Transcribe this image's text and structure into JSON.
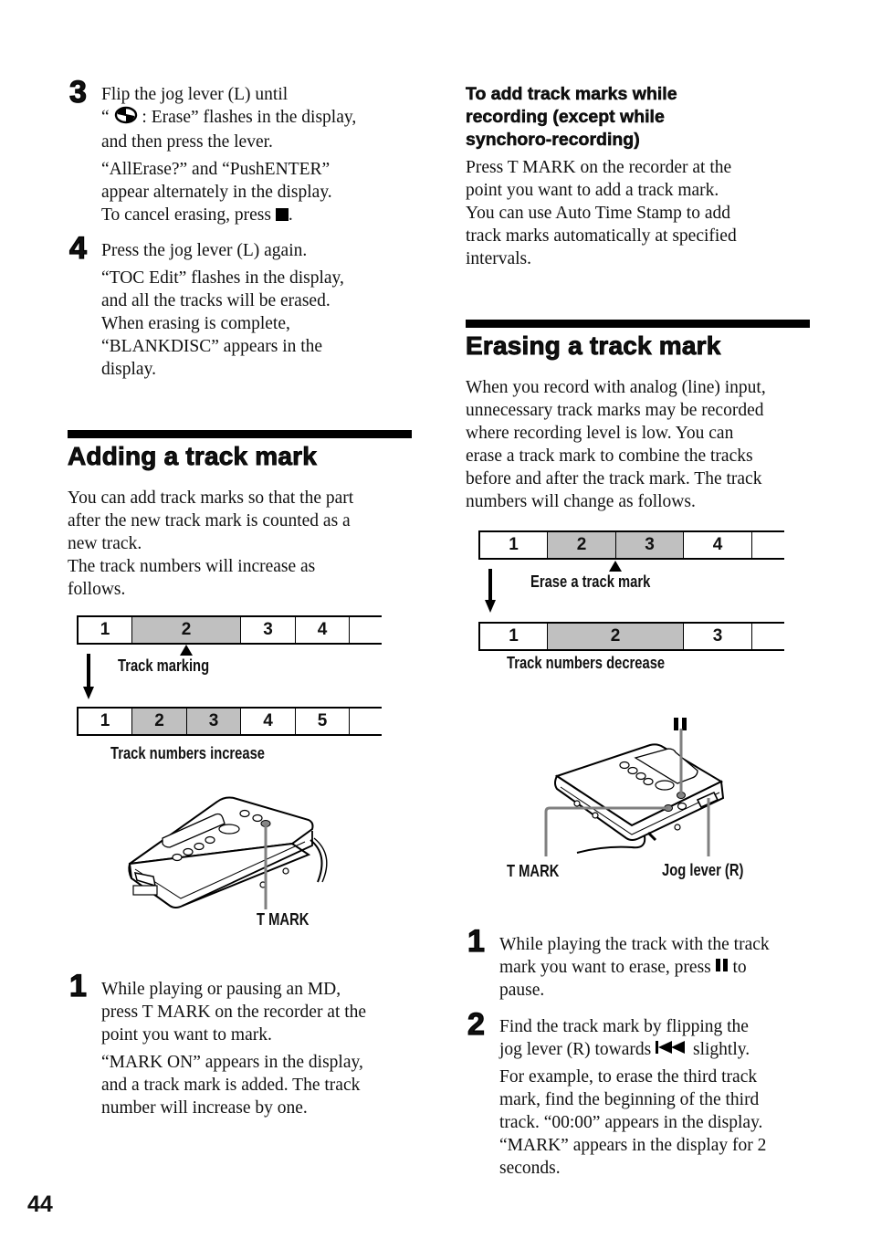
{
  "page_number": "44",
  "left_column": {
    "steps_top": [
      {
        "number": "3",
        "paragraphs": [
          [
            "Flip the jog lever (L) until",
            "“",
            "erase-disc-icon",
            ": Erase” flashes in the display,",
            "and then press the lever."
          ],
          [
            "“AllErase?” and “PushENTER”",
            "appear alternately in the display.",
            "To cancel erasing, press",
            "stop-icon",
            "."
          ]
        ],
        "line1": "Flip the jog lever (L) until",
        "line2_pre": "“",
        "line2_post": " : Erase” flashes in the display,",
        "line3": "and then press the lever.",
        "note1": "“AllErase?” and “PushENTER”",
        "note2": "appear alternately in the display.",
        "note3_pre": "To cancel erasing, press ",
        "note3_post": "."
      },
      {
        "number": "4",
        "line1": "Press the jog lever (L) again.",
        "note1": "“TOC Edit” flashes in the display,",
        "note2": "and all the tracks will be erased.",
        "note3": "When erasing is complete,",
        "note4": "“BLANKDISC” appears in the",
        "note5": "display."
      }
    ],
    "section": {
      "title": "Adding a track mark",
      "intro": [
        "You can add track marks so that the part",
        "after the new track mark is counted as a",
        "new track.",
        "The track numbers will increase as",
        "follows."
      ],
      "diagram": {
        "before_tracks": [
          {
            "label": "1",
            "shaded": false
          },
          {
            "label": "2",
            "shaded": true
          },
          {
            "label": "3",
            "shaded": false
          },
          {
            "label": "4",
            "shaded": false
          },
          {
            "label": "",
            "shaded": false
          }
        ],
        "marker_label": "Track marking",
        "after_tracks": [
          {
            "label": "1",
            "shaded": false
          },
          {
            "label": "2",
            "shaded": true
          },
          {
            "label": "3",
            "shaded": true
          },
          {
            "label": "4",
            "shaded": false
          },
          {
            "label": "5",
            "shaded": false
          },
          {
            "label": "",
            "shaded": false
          }
        ],
        "result_label": "Track numbers increase"
      },
      "illustration": {
        "callouts": [
          "T MARK"
        ]
      },
      "steps": [
        {
          "number": "1",
          "lines": [
            "While playing or pausing an MD,",
            "press T MARK on the recorder at the",
            "point you want to mark."
          ],
          "notes": [
            "“MARK ON” appears in the display,",
            "and a track mark is added. The track",
            "number will increase by one."
          ]
        }
      ]
    }
  },
  "right_column": {
    "subsection": {
      "title_lines": [
        "To add track marks while",
        "recording (except while",
        "synchoro-recording)"
      ],
      "body": [
        "Press T MARK on the recorder at the",
        "point you want to add a track mark.",
        "You can use Auto Time Stamp to add",
        "track marks automatically at specified",
        "intervals."
      ]
    },
    "section": {
      "title": "Erasing a track mark",
      "intro": [
        "When you record with analog (line) input,",
        "unnecessary track marks may be recorded",
        "where recording level is low. You can",
        "erase a track mark to combine the tracks",
        "before and after the track mark. The track",
        "numbers will change as follows."
      ],
      "diagram": {
        "before_tracks": [
          {
            "label": "1",
            "shaded": false
          },
          {
            "label": "2",
            "shaded": true
          },
          {
            "label": "3",
            "shaded": true
          },
          {
            "label": "4",
            "shaded": false
          },
          {
            "label": "",
            "shaded": false
          }
        ],
        "marker_label": "Erase a track mark",
        "after_tracks": [
          {
            "label": "1",
            "shaded": false
          },
          {
            "label": "2",
            "shaded": true
          },
          {
            "label": "3",
            "shaded": false
          },
          {
            "label": "",
            "shaded": false
          }
        ],
        "result_label": "Track numbers decrease"
      },
      "illustration": {
        "callouts": [
          "T MARK",
          "Jog lever (R)"
        ],
        "pause_icon": "pause-icon"
      },
      "steps": [
        {
          "number": "1",
          "line1": "While playing the track with the track",
          "line2_pre": "mark you want to erase, press ",
          "line2_post": " to",
          "line3": "pause."
        },
        {
          "number": "2",
          "line1": "Find the track mark by flipping the",
          "line2_pre": "jog lever (R) towards ",
          "line2_post": " slightly.",
          "notes": [
            "For example, to erase the third track",
            "mark, find the beginning of the third",
            "track. “00:00” appears in the display.",
            "“MARK” appears in the display for 2",
            "seconds."
          ]
        }
      ]
    }
  },
  "colors": {
    "text": "#111111",
    "shaded_track": "#c0c0c0",
    "rule": "#000000",
    "callout_line": "#808080"
  }
}
